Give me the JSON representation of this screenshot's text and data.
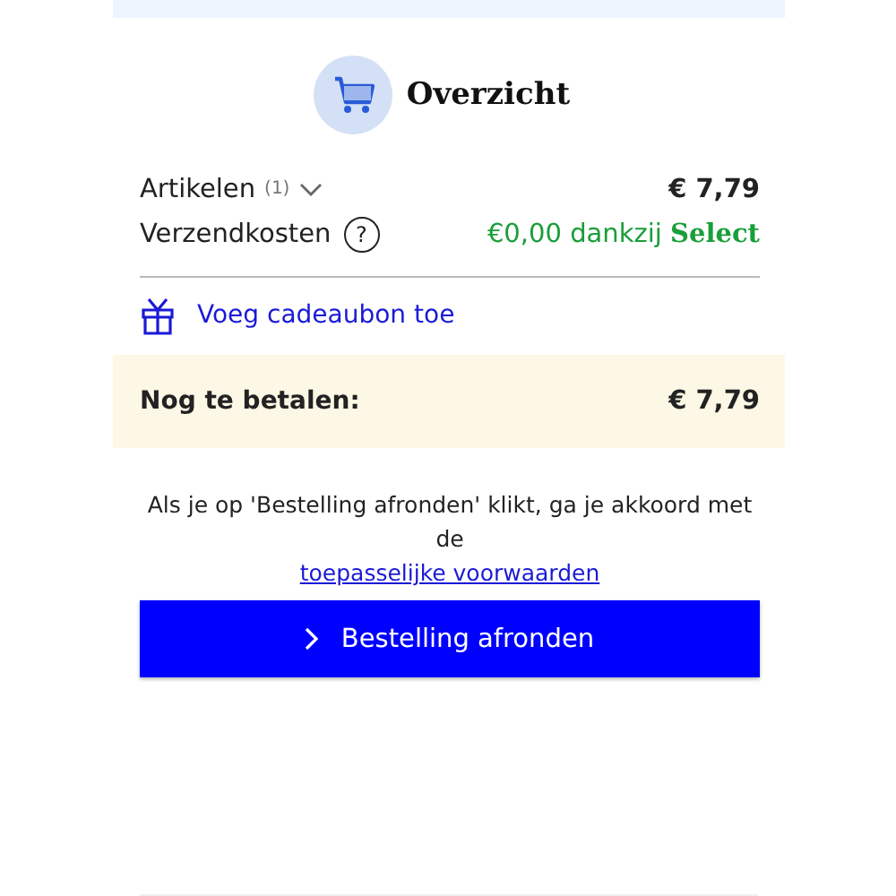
{
  "title": "Overzicht",
  "articles": {
    "label": "Artikelen",
    "count": "(1)",
    "amount": "€ 7,79"
  },
  "shipping": {
    "label": "Verzendkosten",
    "help": "?",
    "value": "€0,00 dankzij",
    "highlight": "Select"
  },
  "voucher": {
    "label": "Voeg cadeaubon toe"
  },
  "total": {
    "label": "Nog te betalen:",
    "amount": "€ 7,79"
  },
  "terms": {
    "text": "Als je op 'Bestelling afronden' klikt, ga je akkoord met de",
    "link": "toepasselijke voorwaarden"
  },
  "button": {
    "label": "Bestelling afronden"
  }
}
